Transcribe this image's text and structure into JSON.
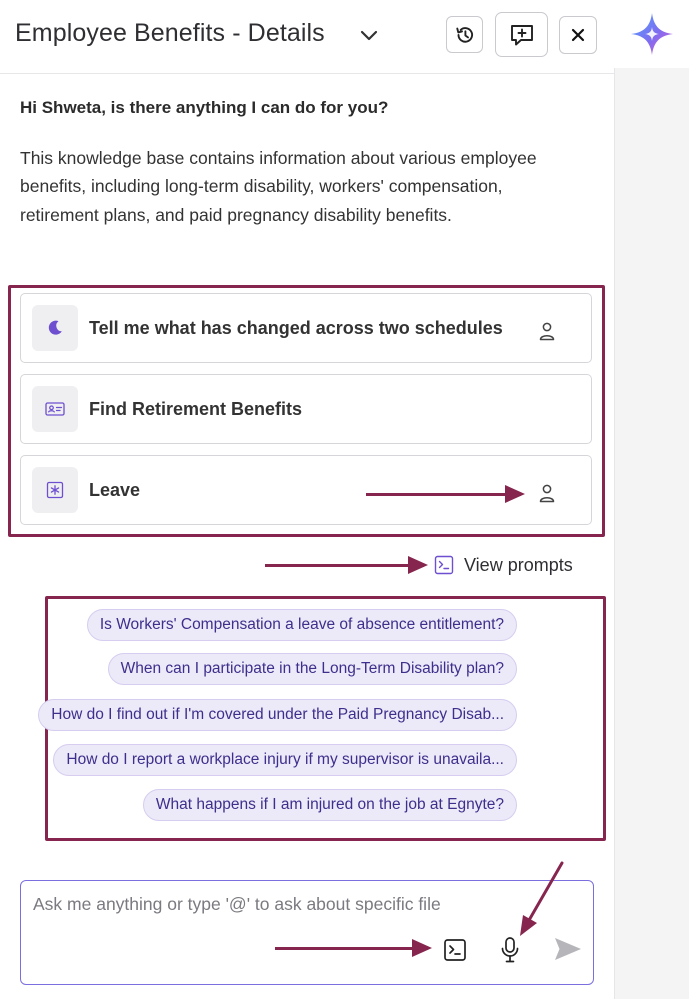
{
  "header": {
    "title": "Employee Benefits - Details",
    "icons": {
      "chevron": "chevron-down-icon",
      "history": "history-icon",
      "new_chat": "new-chat-icon",
      "close": "close-icon",
      "logo": "sparkle-logo-icon"
    }
  },
  "intro": {
    "greeting": "Hi Shweta, is there anything I can do for you?",
    "description": "This knowledge base contains information about various employee benefits, including long-term disability, workers' compensation, retirement plans, and paid pregnancy disability benefits."
  },
  "prompt_cards": [
    {
      "label": "Tell me what has changed across two schedules",
      "icon": "moon-icon",
      "shared": true
    },
    {
      "label": "Find Retirement Benefits",
      "icon": "id-card-icon",
      "shared": false
    },
    {
      "label": "Leave",
      "icon": "asterisk-box-icon",
      "shared": true
    }
  ],
  "view_prompts": {
    "label": "View prompts",
    "icon": "prompt-terminal-icon"
  },
  "suggestions": [
    "Is Workers' Compensation a leave of absence entitlement?",
    "When can I participate in the Long-Term Disability plan?",
    "How do I find out if I'm covered under the Paid Pregnancy Disab...",
    "How do I report a workplace injury if my supervisor is unavaila...",
    "What happens if I am injured on the job at Egnyte?"
  ],
  "input": {
    "placeholder": "Ask me anything or type '@' to ask about specific file",
    "value": "",
    "icons": {
      "prompt": "prompt-terminal-icon",
      "mic": "microphone-icon",
      "send": "send-icon"
    }
  },
  "colors": {
    "annotation": "#86264f",
    "chip_bg": "#ece9f8",
    "chip_text": "#3e2f8c",
    "accent": "#7b6fe0"
  }
}
